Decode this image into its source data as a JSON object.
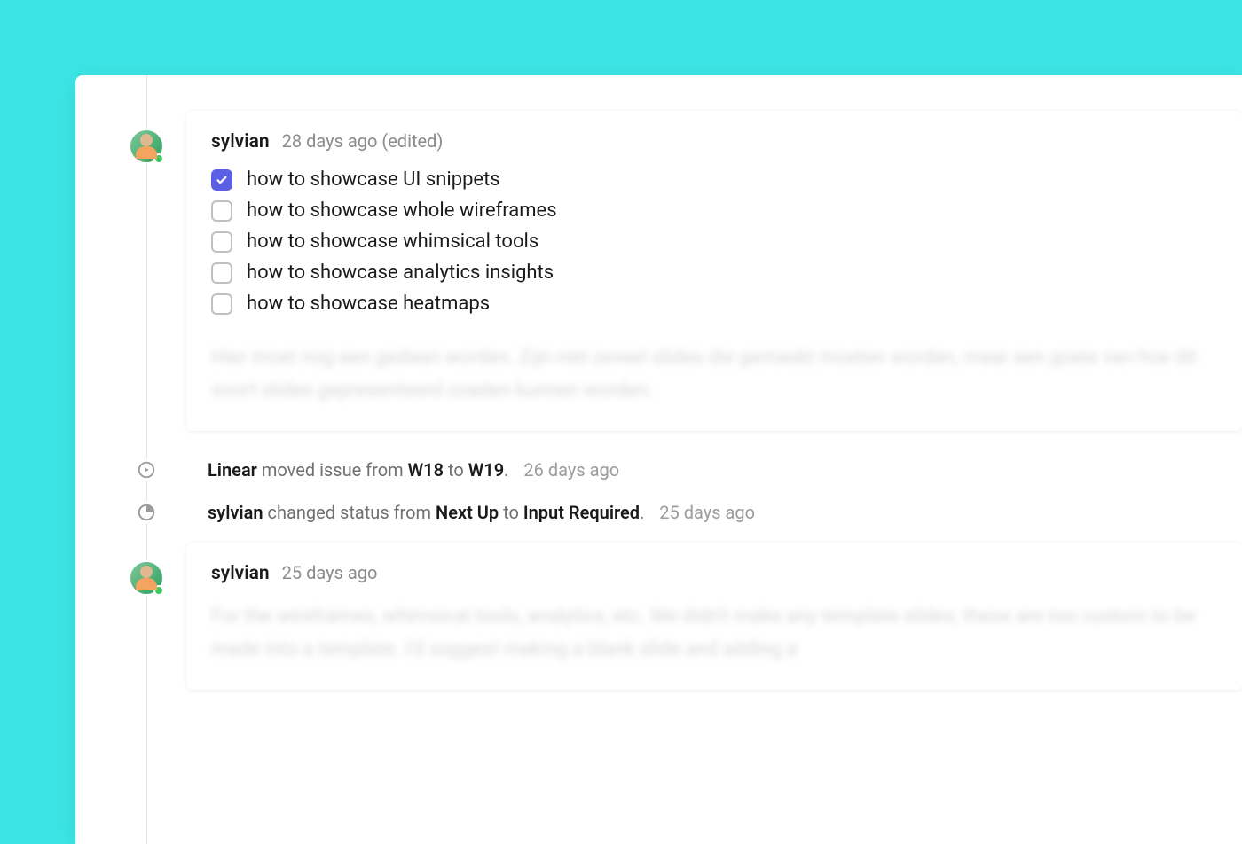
{
  "comments": [
    {
      "author": "sylvian",
      "timestamp": "28 days ago (edited)",
      "checklist": [
        {
          "checked": true,
          "label": "how to showcase UI snippets"
        },
        {
          "checked": false,
          "label": "how to showcase whole wireframes"
        },
        {
          "checked": false,
          "label": "how to showcase whimsical tools"
        },
        {
          "checked": false,
          "label": "how to showcase analytics insights"
        },
        {
          "checked": false,
          "label": "how to showcase heatmaps"
        }
      ],
      "blurred": "Hier moet nog een gedaan worden. Zijn niet zeveel slides die gemaakt moeten worden, maar een goeie van hoe dit soort slides gepresenteerd zoaden kunnen worden."
    },
    {
      "author": "sylvian",
      "timestamp": "25 days ago",
      "blurred": "For the wireframes, whimsical tools, analytics, etc. We didn't make any template slides, these are too custom to be made into a template. I'd suggest making a blank slide and adding a"
    }
  ],
  "activities": [
    {
      "icon": "cycle",
      "actor": "Linear",
      "verb": "moved issue from",
      "from": "W18",
      "to_prefix": "to",
      "to": "W19",
      "suffix": ".",
      "time": "26 days ago"
    },
    {
      "icon": "status",
      "actor": "sylvian",
      "verb": "changed status from",
      "from": "Next Up",
      "to_prefix": "to",
      "to": "Input Required",
      "suffix": ".",
      "time": "25 days ago"
    }
  ]
}
